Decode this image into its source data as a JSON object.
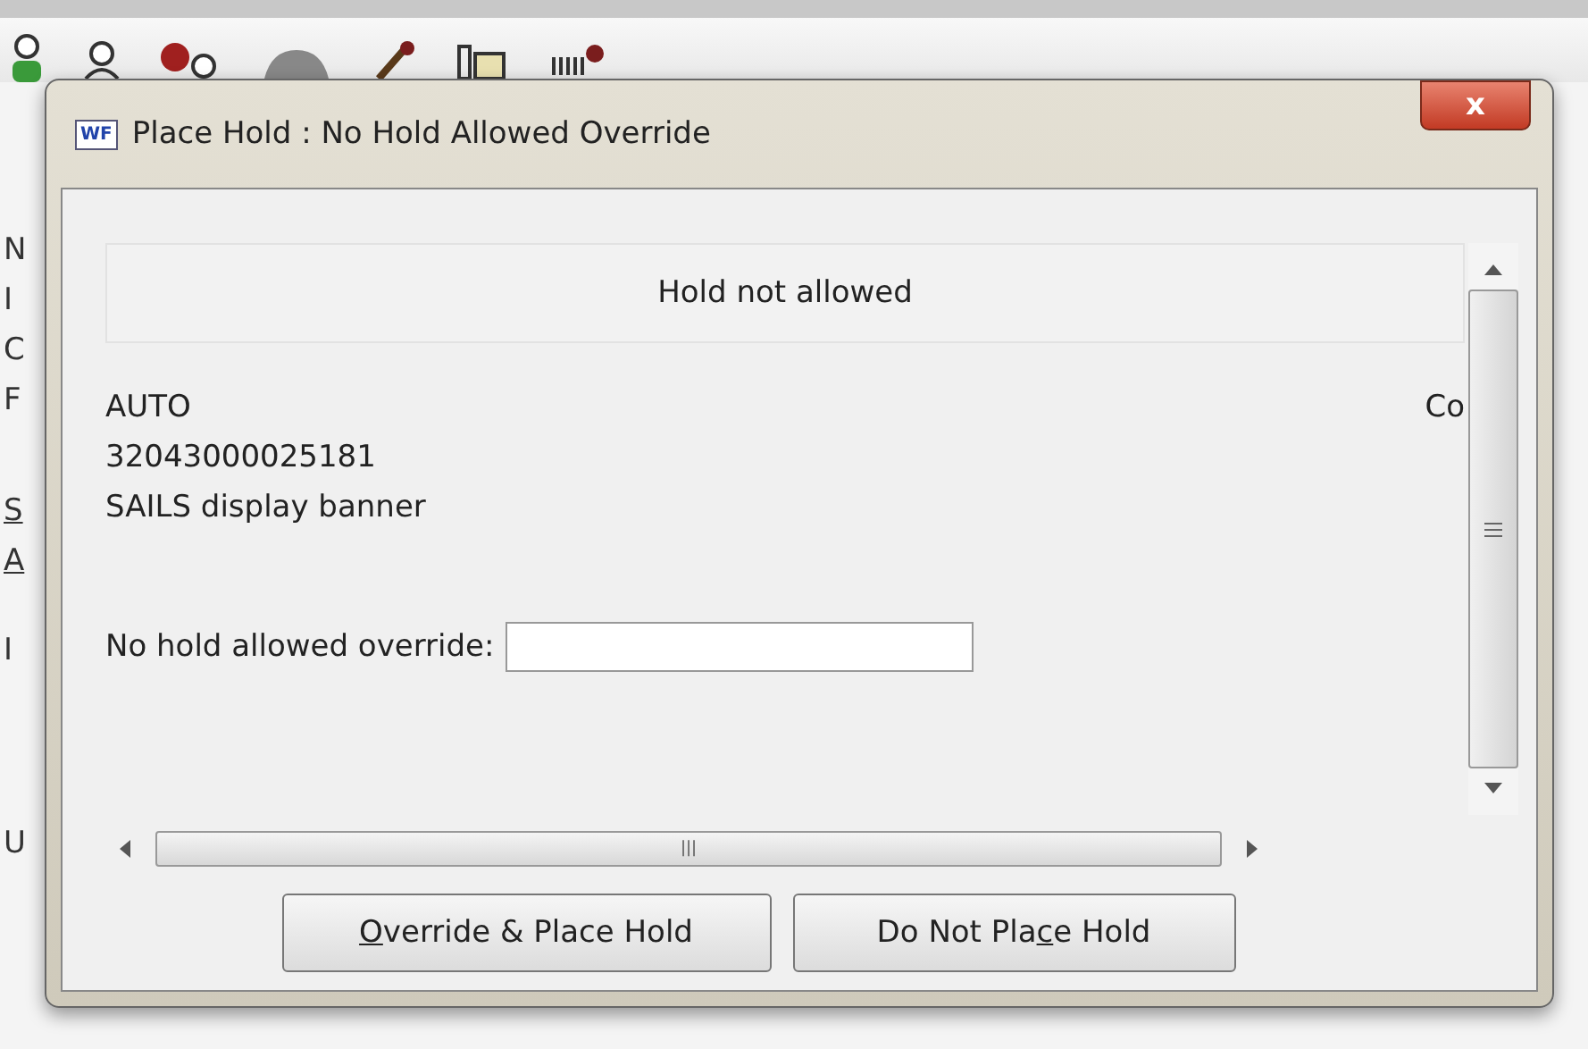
{
  "background": {
    "side_letters": [
      {
        "text": "N",
        "underlined": false
      },
      {
        "text": "I",
        "underlined": false
      },
      {
        "text": "C",
        "underlined": false
      },
      {
        "text": "F",
        "underlined": false
      },
      {
        "text": "S",
        "underlined": true
      },
      {
        "text": "A",
        "underlined": true
      },
      {
        "text": "I",
        "underlined": false
      },
      {
        "text": "U",
        "underlined": false
      }
    ]
  },
  "dialog": {
    "title": "Place Hold : No Hold Allowed Override",
    "app_badge": "WF",
    "close": "x",
    "header": "Hold not allowed",
    "details": [
      "AUTO",
      "32043000025181",
      "SAILS display banner"
    ],
    "right_cut": "Co",
    "field": {
      "label": "No hold allowed override:"
    },
    "scrollbar_grip": "|||",
    "buttons": [
      {
        "key": "O",
        "after": "verride & Place Hold"
      },
      {
        "before": "Do Not Pla",
        "key": "c",
        "after": "e Hold"
      }
    ]
  }
}
